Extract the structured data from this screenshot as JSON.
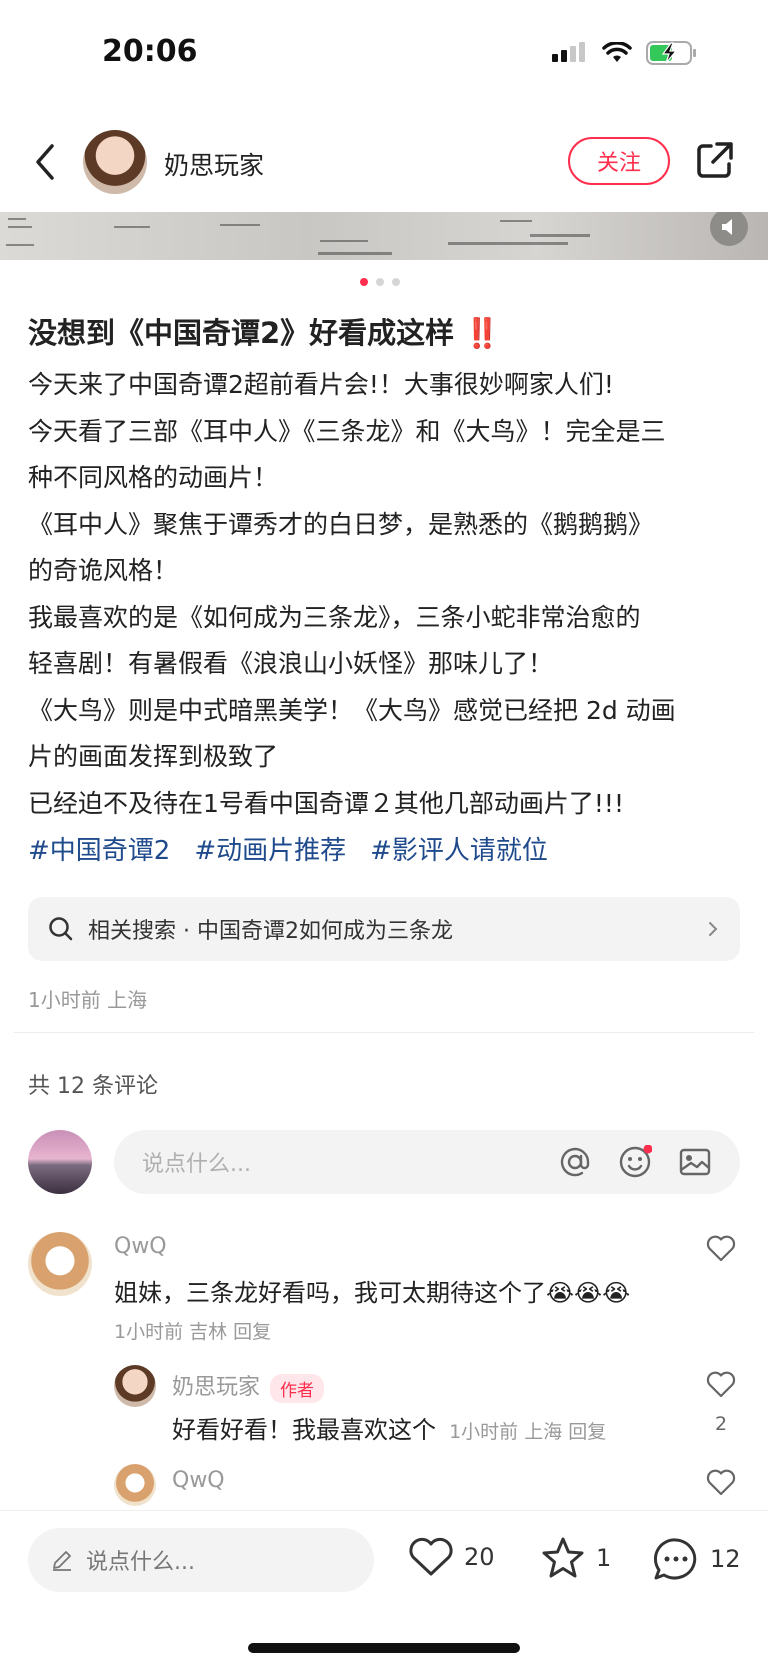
{
  "status_bar": {
    "time": "20:06"
  },
  "header": {
    "author_name": "奶思玩家",
    "follow_label": "关注"
  },
  "image": {
    "carousel_index": 1,
    "carousel_total": 3
  },
  "post": {
    "title": "没想到《中国奇谭2》好看成这样",
    "title_mark": "‼️",
    "body_lines": [
      "今天来了中国奇谭2超前看片会!！大事很妙啊家人们!",
      "今天看了三部《耳中人》《三条龙》和《大鸟》！完全是三",
      "种不同风格的动画片！",
      "《耳中人》聚焦于谭秀才的白日梦，是熟悉的《鹅鹅鹅》",
      "的奇诡风格！",
      "我最喜欢的是《如何成为三条龙》，三条小蛇非常治愈的",
      "轻喜剧！有暑假看《浪浪山小妖怪》那味儿了！",
      "《大鸟》则是中式暗黑美学！《大鸟》感觉已经把 2d 动画",
      "片的画面发挥到极致了",
      "已经迫不及待在1号看中国奇谭２其他几部动画片了!!!"
    ],
    "tags": [
      "#中国奇谭2",
      "#动画片推荐",
      "#影评人请就位"
    ],
    "related_search": "相关搜索 · 中国奇谭2如何成为三条龙",
    "meta": "1小时前 上海"
  },
  "comments": {
    "count_label": "共 12 条评论",
    "input_placeholder": "说点什么...",
    "items": [
      {
        "user": "QwQ",
        "text": "姐妹，三条龙好看吗，我可太期待这个了",
        "emoji": "😭😭😭",
        "meta": "1小时前 吉林 回复"
      },
      {
        "user": "奶思玩家",
        "badge": "作者",
        "text": "好看好看！我最喜欢这个",
        "meta": "1小时前 上海 回复",
        "likes": "2"
      },
      {
        "user": "QwQ"
      }
    ]
  },
  "bottom_bar": {
    "input_placeholder": "说点什么...",
    "likes": "20",
    "stars": "1",
    "comments": "12"
  },
  "colors": {
    "accent": "#ff2e4d",
    "tag": "#1f4a8c"
  }
}
